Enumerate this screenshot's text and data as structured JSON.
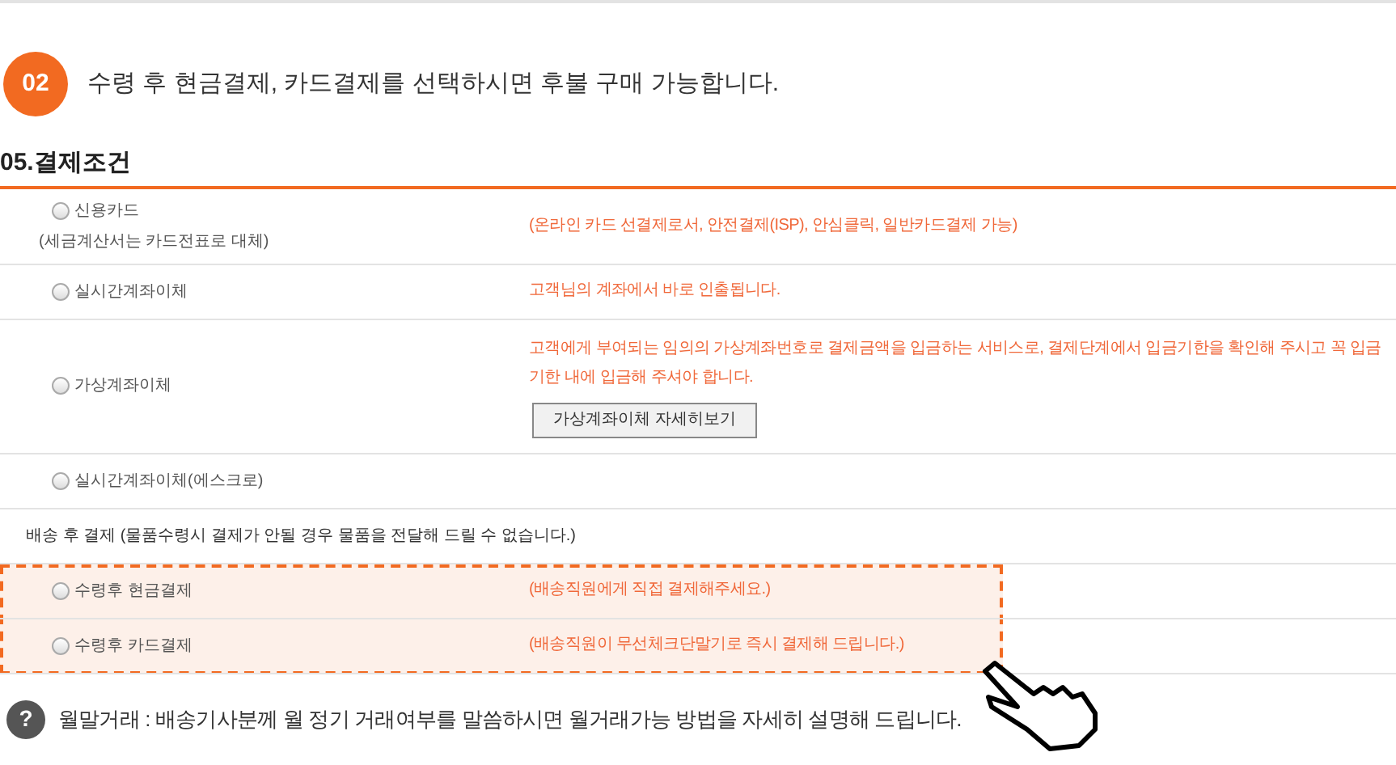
{
  "step": {
    "number": "02",
    "text": "수령 후 현금결제, 카드결제를 선택하시면 후불 구매 가능합니다."
  },
  "section_title": "05.결제조건",
  "options": [
    {
      "label": "신용카드",
      "sublabel": "(세금계산서는 카드전표로 대체)",
      "description": "(온라인 카드 선결제로서, 안전결제(ISP), 안심클릭, 일반카드결제 가능)",
      "selected": false
    },
    {
      "label": "실시간계좌이체",
      "description": "고객님의 계좌에서 바로 인출됩니다.",
      "selected": false
    },
    {
      "label": "가상계좌이체",
      "description": "고객에게 부여되는 임의의 가상계좌번호로 결제금액을 입금하는 서비스로, 결제단계에서 입금기한을 확인해 주시고 꼭 입금기한 내에 입금해 주셔야 합니다.",
      "button": "가상계좌이체 자세히보기",
      "selected": false
    },
    {
      "label": "실시간계좌이체(에스크로)",
      "selected": false
    }
  ],
  "after_delivery": {
    "note": "배송 후 결제 (물품수령시 결제가 안될 경우 물품을 전달해 드릴 수 없습니다.)",
    "options": [
      {
        "label": "수령후 현금결제",
        "description": "(배송직원에게 직접 결제해주세요.)",
        "selected": false
      },
      {
        "label": "수령후 카드결제",
        "description": "(배송직원이 무선체크단말기로 즉시 결제해 드립니다.)",
        "selected": false
      }
    ]
  },
  "footer": {
    "icon": "?",
    "text": "월말거래 : 배송기사분께 월 정기 거래여부를 말씀하시면 월거래가능 방법을 자세히 설명해 드립니다."
  }
}
